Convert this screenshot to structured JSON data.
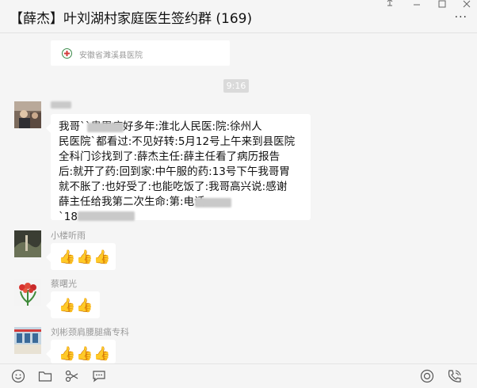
{
  "chat": {
    "title": "【薛杰】叶刘湖村家庭医生签约群 (169)",
    "link_card": {
      "source": "安徽省濉溪县医院"
    },
    "timestamp": "9:16",
    "messages": [
      {
        "sender": "",
        "text_lines": [
          "我哥``患胃病好多年:淮北人民医:院:徐州人",
          "民医院`都看过:不见好转:5月12号上午来到县医院",
          "全科门诊找到了:薛杰主任:薛主任看了病历报告",
          "后:就开了药:回到家:中午服的药:13号下午我哥胃",
          "就不胀了:也好受了:也能吃饭了:我哥高兴说:感谢",
          "薛主任给我第二次生命:第:电话",
          "`18"
        ]
      },
      {
        "sender": "小楼听雨",
        "reaction": "👍👍👍"
      },
      {
        "sender": "蔡曙光",
        "reaction": "👍👍"
      },
      {
        "sender": "刘彬颈肩腰腿痛专科",
        "reaction": "👍👍👍"
      }
    ]
  },
  "colors": {
    "bubble": "#ffffff",
    "background": "#f5f5f5",
    "nickname": "#9a9a9a",
    "thumbs": "#f2b33d"
  },
  "icons": [
    "pin-icon",
    "minimize-icon",
    "maximize-icon",
    "close-icon",
    "more-icon",
    "emoji-icon",
    "folder-icon",
    "scissors-icon",
    "chat-bubble-icon",
    "live-icon",
    "phone-icon"
  ]
}
